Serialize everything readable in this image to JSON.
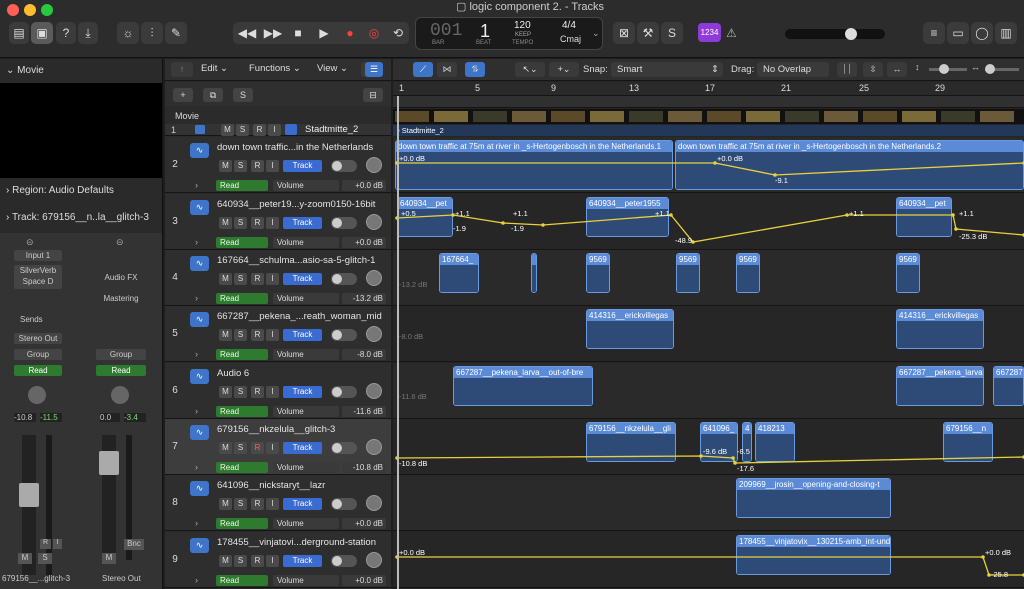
{
  "window": {
    "title": "logic component 2. - Tracks"
  },
  "lcd": {
    "bar": "1",
    "beat": "1",
    "bar_label": "BAR",
    "beat_label": "BEAT",
    "tempo": "120",
    "keep": "KEEP",
    "tempo_label": "TEMPO",
    "sig": "4/4",
    "key": "Cmaj",
    "bars_display": "001"
  },
  "toolbar": {
    "badge": "1234"
  },
  "edit": {
    "edit": "Edit",
    "functions": "Functions",
    "view": "View",
    "snap_label": "Snap:",
    "snap_value": "Smart",
    "drag_label": "Drag:",
    "drag_value": "No Overlap"
  },
  "inspector": {
    "movie": "Movie",
    "region": "Region: Audio Defaults",
    "track": "Track:  679156__n..la__glitch-3",
    "input": "Input 1",
    "silververb": "SilverVerb",
    "space": "Space D",
    "audiofx": "Audio FX",
    "mastering": "Mastering",
    "sends": "Sends",
    "stereo_out": "Stereo Out",
    "group": "Group",
    "read": "Read",
    "vol_l": "-10.8",
    "peak_l": "-11.5",
    "vol_r": "0.0",
    "peak_r": "-3.4",
    "m": "M",
    "s": "S",
    "r": "R",
    "i": "I",
    "bnc": "Bnc",
    "ch1": "679156__...glitch-3",
    "ch2": "Stereo Out"
  },
  "header": {
    "movie": "Movie"
  },
  "ruler": [
    "1",
    "5",
    "9",
    "13",
    "17",
    "21",
    "25",
    "29"
  ],
  "tracks": [
    {
      "num": "1",
      "name": "Stadtmitte_2",
      "video": true
    },
    {
      "num": "2",
      "name": "down town traffic...in the Netherlands",
      "vol": "+0.0 dB",
      "read": "Read",
      "param": "Volume"
    },
    {
      "num": "3",
      "name": "640934__peter19...y-zoom0150-16bit",
      "vol": "+0.0 dB",
      "read": "Read",
      "param": "Volume"
    },
    {
      "num": "4",
      "name": "167664__schulma...asio-sa-5-glitch-1",
      "vol": "-13.2 dB",
      "read": "Read",
      "param": "Volume"
    },
    {
      "num": "5",
      "name": "667287__pekena_...reath_woman_mid",
      "vol": "-8.0 dB",
      "read": "Read",
      "param": "Volume"
    },
    {
      "num": "6",
      "name": "Audio 6",
      "vol": "-11.6 dB",
      "read": "Read",
      "param": "Volume"
    },
    {
      "num": "7",
      "name": "679156__nkzelula__glitch-3",
      "vol": "-10.8 dB",
      "read": "Read",
      "param": "Volume"
    },
    {
      "num": "8",
      "name": "641096__nickstaryt__lazr",
      "vol": "+0.0 dB",
      "read": "Read",
      "param": "Volume"
    },
    {
      "num": "9",
      "name": "178455__vinjatovi...derground-station",
      "vol": "+0.0 dB",
      "read": "Read",
      "param": "Volume"
    }
  ],
  "btn": {
    "m": "M",
    "s": "S",
    "r": "R",
    "i": "I",
    "track": "Track"
  },
  "regions": {
    "v1": "Stadtmitte_2",
    "r2a": "down town traffic at 75m at river in _s-Hertogenbosch in the Netherlands.1",
    "r2b": "down town traffic at 75m at river in _s-Hertogenbosch in the Netherlands.2",
    "r3a": "640934__pet",
    "r3b": "640934__peter1955",
    "r3c": "640934__pet",
    "r4a": "167664_",
    "r4b": "9569",
    "r4c": "9569",
    "r4d": "9569",
    "r4e": "9569",
    "r5a": "414316__erickvillegas",
    "r5b": "414316__erickvillegas",
    "r6a": "667287__pekena_larva__out-of-bre",
    "r6b": "667287__pekena_larva",
    "r6c": "667287",
    "r7a": "679156__nkzelula__gli",
    "r7b": "641096_",
    "r7c": "4",
    "r7d": "418213",
    "r7e": "679156__n",
    "r8a": "209969__jrosin__opening-and-closing-t",
    "r9a": "178455__vinjatovix__130215-amb_int-und"
  },
  "auto": {
    "t2": [
      "+0.0 dB",
      "+0.0 dB",
      "-9.1"
    ],
    "t3": [
      "+0.5",
      "+1.1",
      "-1.9",
      "+1.1",
      "-1.9",
      "+1.1",
      "-48.9",
      "+1.1",
      "+1.1",
      "-25.3 dB"
    ],
    "t4": "-13.2 dB",
    "t5": "-8.0 dB",
    "t6": "-11.6 dB",
    "t7": [
      "-10.8 dB",
      "-9.6 dB",
      "-8.5",
      "-17.6"
    ],
    "t9": [
      "+0.0 dB",
      "+0.0 dB",
      "-25.8"
    ]
  }
}
